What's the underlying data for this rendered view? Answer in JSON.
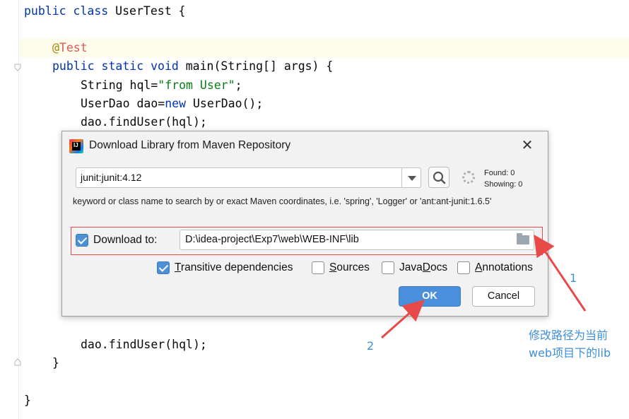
{
  "editor": {
    "lines": {
      "class_decl_kw": "public class",
      "class_decl_name": " UserTest {",
      "annotation_at": "@",
      "annotation_name": "Test",
      "main_kw": "public static void",
      "main_sig": " main(String[] args) {",
      "hql_decl": "String hql=",
      "hql_value": "\"from User\"",
      "hql_end": ";",
      "dao_decl": "UserDao dao=",
      "dao_new": "new",
      "dao_end": " UserDao();",
      "find_user_1": "dao.findUser(hql);",
      "find_user_2": "dao.findUser(hql);",
      "close_method": "}",
      "close_class": "}"
    }
  },
  "dialog": {
    "title": "Download Library from Maven Repository",
    "close_symbol": "✕",
    "coordinate_value": "junit:junit:4.12",
    "found": "Found: 0",
    "showing": "Showing: 0",
    "hint": "keyword or class name to search by or exact Maven coordinates, i.e. 'spring', 'Logger' or 'ant:ant-junit:1.6.5'",
    "download_to_label": "Download to:",
    "download_to_path": "D:\\idea-project\\Exp7\\web\\WEB-INF\\lib",
    "options": {
      "transitive_first": "T",
      "transitive_rest": "ransitive dependencies",
      "sources_first": "S",
      "sources_rest": "ources",
      "javadocs_pre": "Java",
      "javadocs_u": "D",
      "javadocs_rest": "ocs",
      "annotations_first": "A",
      "annotations_rest": "nnotations"
    },
    "ok_label": "OK",
    "cancel_label": "Cancel"
  },
  "annotations": {
    "step1": "1",
    "step2": "2",
    "note_line1": "修改路径为当前",
    "note_line2": "web项目下的lib"
  },
  "colors": {
    "accent_blue": "#4a8fdb",
    "highlight_red": "#e84a4a",
    "note_blue": "#3d8fd9"
  }
}
